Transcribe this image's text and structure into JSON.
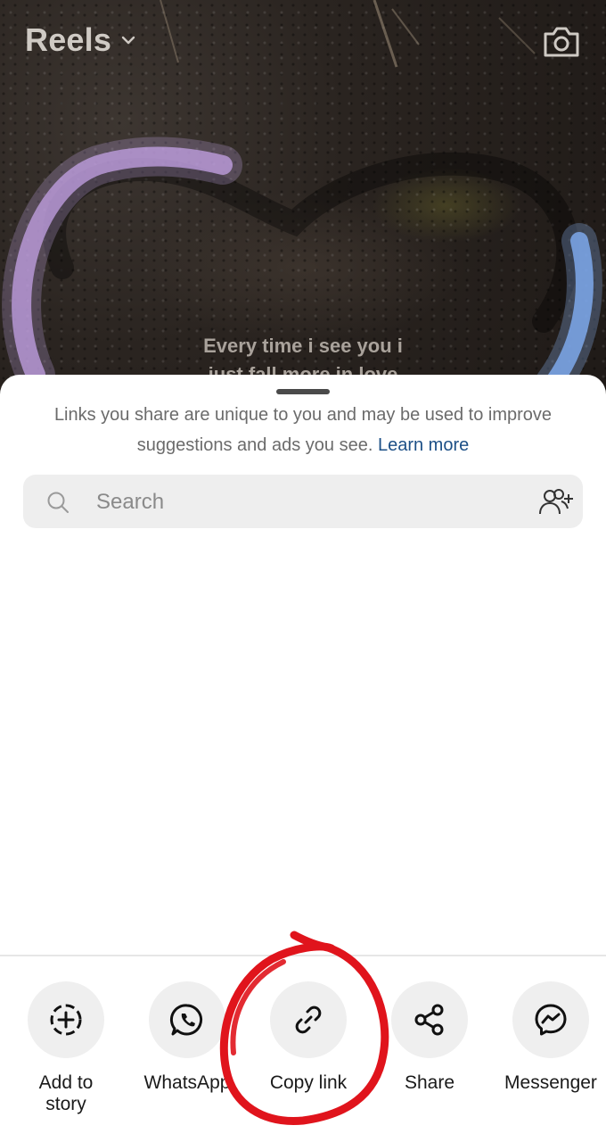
{
  "background": {
    "title": "Reels",
    "caption_line1": "Every time i see you i",
    "caption_line2": "just fall more in love"
  },
  "sheet": {
    "notice_text": "Links you share are unique to you and may be used to improve suggestions and ads you see.",
    "learn_more": "Learn more",
    "search_placeholder": "Search"
  },
  "share_targets": [
    {
      "label": "Add to story",
      "icon": "add-story-icon"
    },
    {
      "label": "WhatsApp",
      "icon": "whatsapp-icon"
    },
    {
      "label": "Copy link",
      "icon": "link-icon"
    },
    {
      "label": "Share",
      "icon": "share-icon"
    },
    {
      "label": "Messenger",
      "icon": "messenger-icon"
    }
  ],
  "colors": {
    "link_blue": "#1c4f86",
    "annotation_red": "#e0141c"
  }
}
